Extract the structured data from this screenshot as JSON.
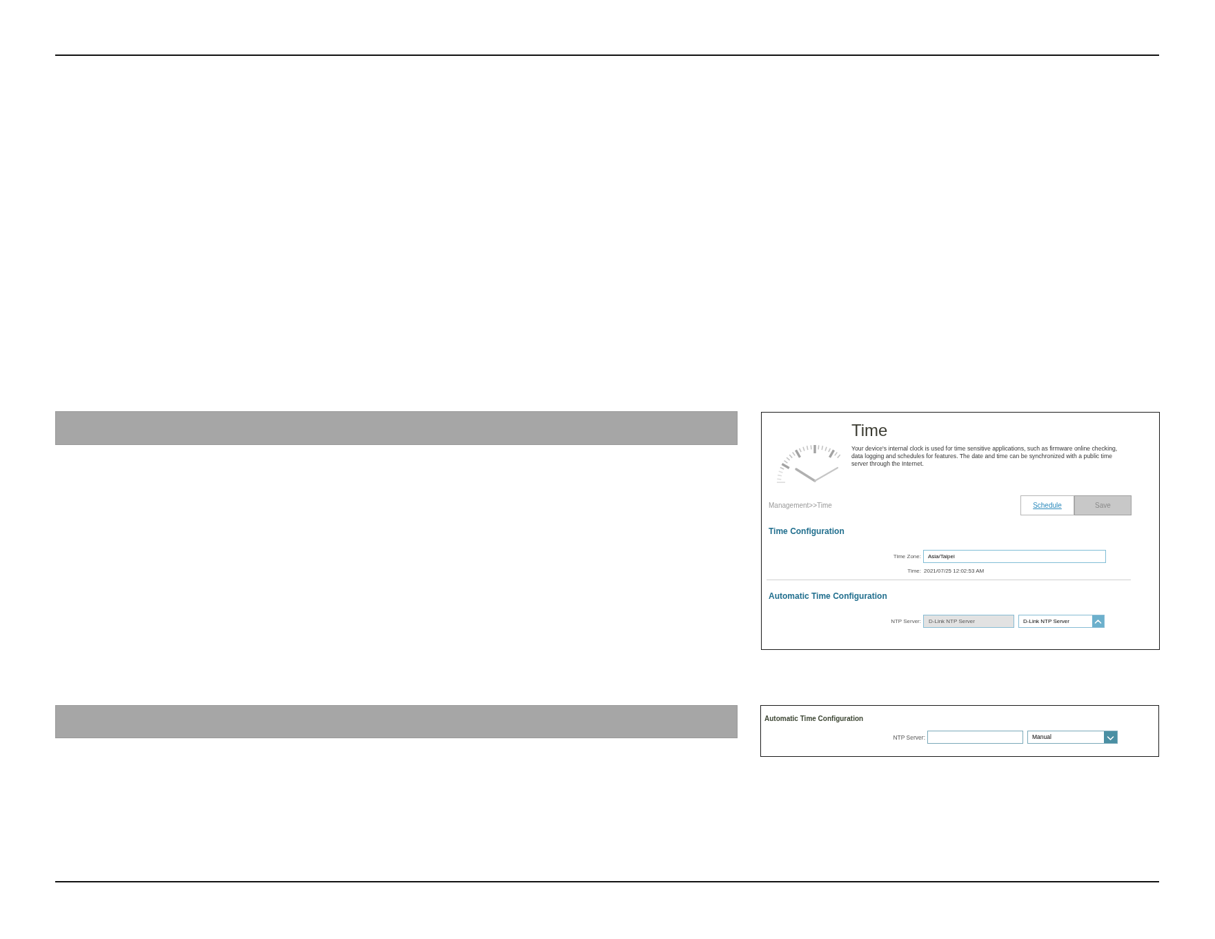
{
  "panels": [
    {
      "kind": "full",
      "title": "Time",
      "description": "Your device's internal clock is used for time sensitive applications, such as firmware online checking, data logging and schedules for features. The date and time can be synchronized with a public time server through the Internet.",
      "breadcrumb": "Management>>Time",
      "buttons": [
        {
          "label": "Schedule",
          "disabled": false
        },
        {
          "label": "Save",
          "disabled": true
        }
      ],
      "sections": [
        {
          "heading": "Time Configuration",
          "fields": [
            {
              "kind": "input",
              "label": "Time Zone:",
              "value": "Asia/Taipei"
            },
            {
              "kind": "text",
              "label": "Time:",
              "value": "2021/07/25 12:02:53 AM"
            }
          ]
        },
        {
          "heading": "Automatic Time Configuration",
          "fields": [
            {
              "kind": "server",
              "label": "NTP Server:",
              "value": "D-Link NTP Server",
              "disabled": true,
              "dropdown": {
                "value": "D-Link NTP Server",
                "expanded": true
              }
            }
          ]
        }
      ]
    },
    {
      "kind": "excerpt",
      "sections": [
        {
          "heading": "Automatic Time Configuration",
          "fields": [
            {
              "kind": "server",
              "label": "NTP Server:",
              "disabled": false,
              "dropdown": {
                "value": "Manual",
                "expanded": false
              }
            }
          ]
        }
      ]
    }
  ]
}
